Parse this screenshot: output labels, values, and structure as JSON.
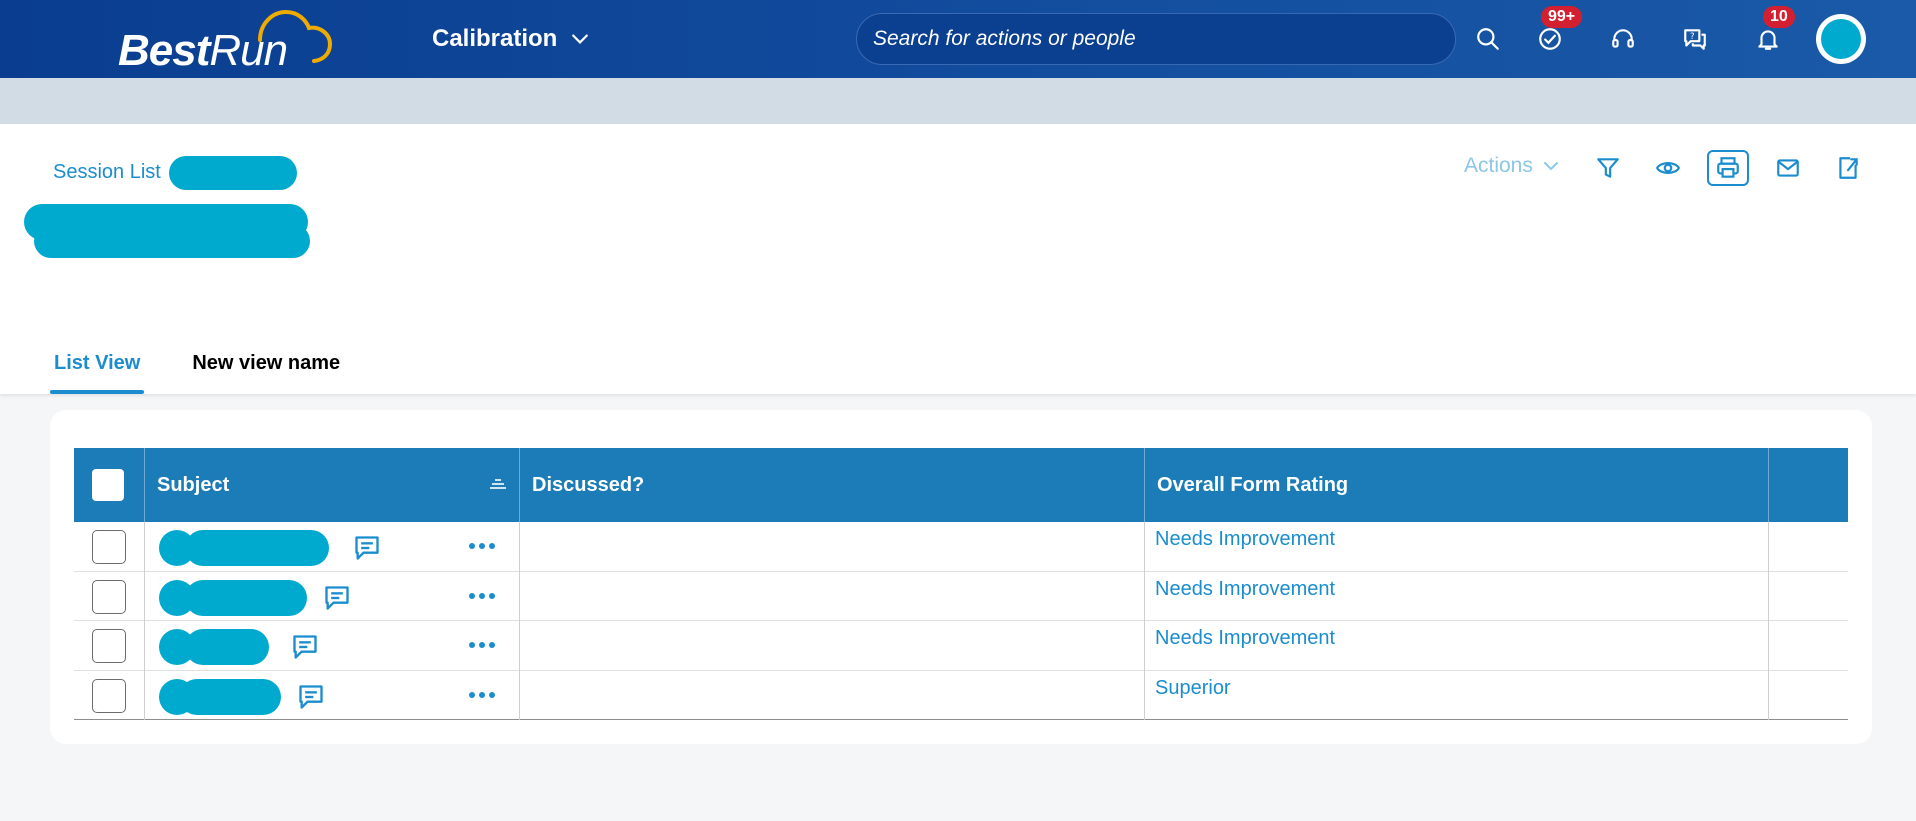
{
  "shell": {
    "logo_bold": "Best",
    "logo_light": "Run",
    "product_name": "Calibration",
    "search_placeholder": "Search for actions or people",
    "tasks_badge": "99+",
    "notifications_badge": "10"
  },
  "header": {
    "breadcrumb": "Session List",
    "actions_label": "Actions"
  },
  "tabs": [
    {
      "label": "List View"
    },
    {
      "label": "New view name"
    }
  ],
  "table": {
    "columns": [
      "Subject",
      "Discussed?",
      "Overall Form Rating"
    ],
    "rows": [
      {
        "discussed": "",
        "rating": "Needs Improvement"
      },
      {
        "discussed": "",
        "rating": "Needs Improvement"
      },
      {
        "discussed": "",
        "rating": "Needs Improvement"
      },
      {
        "discussed": "",
        "rating": "Superior"
      }
    ]
  },
  "colors": {
    "shellbar": "#0a3d8f",
    "accent": "#1b8dcf",
    "table_header": "#1b7cb8",
    "redaction": "#00a9ce",
    "badge": "#d32030"
  }
}
